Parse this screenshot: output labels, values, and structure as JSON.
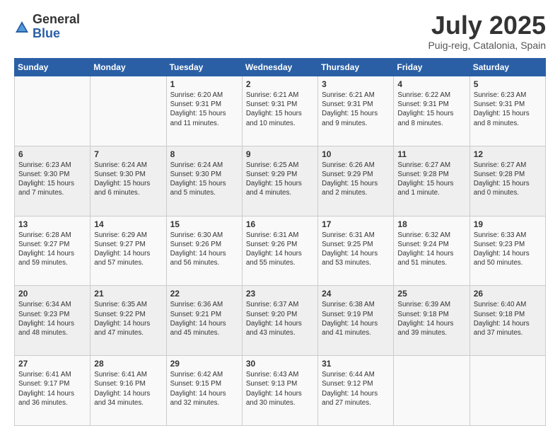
{
  "header": {
    "logo_general": "General",
    "logo_blue": "Blue",
    "month": "July 2025",
    "location": "Puig-reig, Catalonia, Spain"
  },
  "weekdays": [
    "Sunday",
    "Monday",
    "Tuesday",
    "Wednesday",
    "Thursday",
    "Friday",
    "Saturday"
  ],
  "weeks": [
    [
      {
        "day": "",
        "info": ""
      },
      {
        "day": "",
        "info": ""
      },
      {
        "day": "1",
        "info": "Sunrise: 6:20 AM\nSunset: 9:31 PM\nDaylight: 15 hours and 11 minutes."
      },
      {
        "day": "2",
        "info": "Sunrise: 6:21 AM\nSunset: 9:31 PM\nDaylight: 15 hours and 10 minutes."
      },
      {
        "day": "3",
        "info": "Sunrise: 6:21 AM\nSunset: 9:31 PM\nDaylight: 15 hours and 9 minutes."
      },
      {
        "day": "4",
        "info": "Sunrise: 6:22 AM\nSunset: 9:31 PM\nDaylight: 15 hours and 8 minutes."
      },
      {
        "day": "5",
        "info": "Sunrise: 6:23 AM\nSunset: 9:31 PM\nDaylight: 15 hours and 8 minutes."
      }
    ],
    [
      {
        "day": "6",
        "info": "Sunrise: 6:23 AM\nSunset: 9:30 PM\nDaylight: 15 hours and 7 minutes."
      },
      {
        "day": "7",
        "info": "Sunrise: 6:24 AM\nSunset: 9:30 PM\nDaylight: 15 hours and 6 minutes."
      },
      {
        "day": "8",
        "info": "Sunrise: 6:24 AM\nSunset: 9:30 PM\nDaylight: 15 hours and 5 minutes."
      },
      {
        "day": "9",
        "info": "Sunrise: 6:25 AM\nSunset: 9:29 PM\nDaylight: 15 hours and 4 minutes."
      },
      {
        "day": "10",
        "info": "Sunrise: 6:26 AM\nSunset: 9:29 PM\nDaylight: 15 hours and 2 minutes."
      },
      {
        "day": "11",
        "info": "Sunrise: 6:27 AM\nSunset: 9:28 PM\nDaylight: 15 hours and 1 minute."
      },
      {
        "day": "12",
        "info": "Sunrise: 6:27 AM\nSunset: 9:28 PM\nDaylight: 15 hours and 0 minutes."
      }
    ],
    [
      {
        "day": "13",
        "info": "Sunrise: 6:28 AM\nSunset: 9:27 PM\nDaylight: 14 hours and 59 minutes."
      },
      {
        "day": "14",
        "info": "Sunrise: 6:29 AM\nSunset: 9:27 PM\nDaylight: 14 hours and 57 minutes."
      },
      {
        "day": "15",
        "info": "Sunrise: 6:30 AM\nSunset: 9:26 PM\nDaylight: 14 hours and 56 minutes."
      },
      {
        "day": "16",
        "info": "Sunrise: 6:31 AM\nSunset: 9:26 PM\nDaylight: 14 hours and 55 minutes."
      },
      {
        "day": "17",
        "info": "Sunrise: 6:31 AM\nSunset: 9:25 PM\nDaylight: 14 hours and 53 minutes."
      },
      {
        "day": "18",
        "info": "Sunrise: 6:32 AM\nSunset: 9:24 PM\nDaylight: 14 hours and 51 minutes."
      },
      {
        "day": "19",
        "info": "Sunrise: 6:33 AM\nSunset: 9:23 PM\nDaylight: 14 hours and 50 minutes."
      }
    ],
    [
      {
        "day": "20",
        "info": "Sunrise: 6:34 AM\nSunset: 9:23 PM\nDaylight: 14 hours and 48 minutes."
      },
      {
        "day": "21",
        "info": "Sunrise: 6:35 AM\nSunset: 9:22 PM\nDaylight: 14 hours and 47 minutes."
      },
      {
        "day": "22",
        "info": "Sunrise: 6:36 AM\nSunset: 9:21 PM\nDaylight: 14 hours and 45 minutes."
      },
      {
        "day": "23",
        "info": "Sunrise: 6:37 AM\nSunset: 9:20 PM\nDaylight: 14 hours and 43 minutes."
      },
      {
        "day": "24",
        "info": "Sunrise: 6:38 AM\nSunset: 9:19 PM\nDaylight: 14 hours and 41 minutes."
      },
      {
        "day": "25",
        "info": "Sunrise: 6:39 AM\nSunset: 9:18 PM\nDaylight: 14 hours and 39 minutes."
      },
      {
        "day": "26",
        "info": "Sunrise: 6:40 AM\nSunset: 9:18 PM\nDaylight: 14 hours and 37 minutes."
      }
    ],
    [
      {
        "day": "27",
        "info": "Sunrise: 6:41 AM\nSunset: 9:17 PM\nDaylight: 14 hours and 36 minutes."
      },
      {
        "day": "28",
        "info": "Sunrise: 6:41 AM\nSunset: 9:16 PM\nDaylight: 14 hours and 34 minutes."
      },
      {
        "day": "29",
        "info": "Sunrise: 6:42 AM\nSunset: 9:15 PM\nDaylight: 14 hours and 32 minutes."
      },
      {
        "day": "30",
        "info": "Sunrise: 6:43 AM\nSunset: 9:13 PM\nDaylight: 14 hours and 30 minutes."
      },
      {
        "day": "31",
        "info": "Sunrise: 6:44 AM\nSunset: 9:12 PM\nDaylight: 14 hours and 27 minutes."
      },
      {
        "day": "",
        "info": ""
      },
      {
        "day": "",
        "info": ""
      }
    ]
  ]
}
